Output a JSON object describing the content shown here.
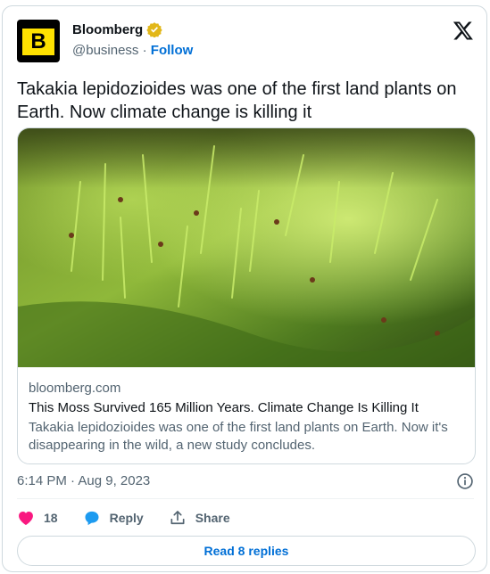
{
  "author": {
    "avatar_letter": "B",
    "name": "Bloomberg",
    "handle": "@business",
    "separator": "·",
    "follow_label": "Follow"
  },
  "tweet": {
    "text": "Takakia lepidozioides was one of the first land plants on Earth. Now climate change is killing it"
  },
  "link_card": {
    "domain": "bloomberg.com",
    "title": "This Moss Survived 165 Million Years. Climate Change Is Killing It",
    "description": "Takakia lepidozioides was one of the first land plants on Earth. Now it's disappearing in the wild, a new study concludes."
  },
  "timestamp": "6:14 PM · Aug 9, 2023",
  "actions": {
    "likes_count": "18",
    "reply_label": "Reply",
    "share_label": "Share"
  },
  "read_replies_label": "Read 8 replies",
  "colors": {
    "accent": "#006fd6",
    "like": "#f91880",
    "reply": "#1d9bf0",
    "verified_gold": "#e2b719",
    "brand_yellow": "#ffe100"
  }
}
